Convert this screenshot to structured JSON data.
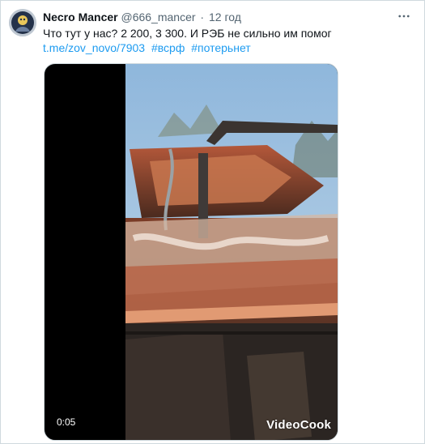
{
  "author": {
    "name": "Necro Mancer",
    "handle": "@666_mancer",
    "separator": "·",
    "time": "12 год"
  },
  "tweet": {
    "text": "Что тут у нас? 2 200, 3 300. И РЭБ не сильно им помог",
    "link": "t.me/zov_novo/7903",
    "hashtags": [
      "#всрф",
      "#потерьнет"
    ]
  },
  "media": {
    "duration": "0:05",
    "watermark": "VideoCook"
  },
  "icons": {
    "avatar": "avatar-image",
    "more": "more-options-icon"
  },
  "colors": {
    "link": "#1d9bf0",
    "text": "#0f1419",
    "secondary": "#536471",
    "border": "#cfd9de"
  }
}
